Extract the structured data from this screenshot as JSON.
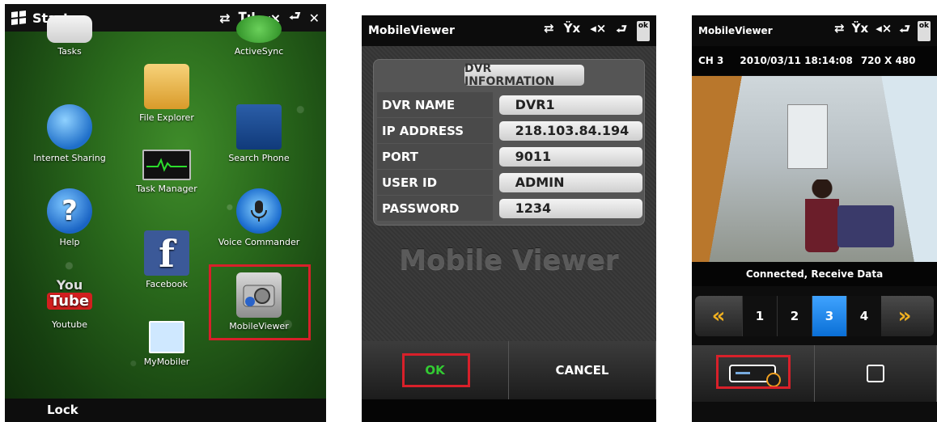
{
  "panel1": {
    "start_title": "Start",
    "status_icons": [
      "⇄",
      "𝐓ıl",
      "◂×",
      "⮐",
      "✕"
    ],
    "apps": [
      {
        "label": "Tasks",
        "icon": "tasks-icon"
      },
      {
        "label": "ActiveSync",
        "icon": "activesync-icon"
      },
      {
        "label": "File Explorer",
        "icon": "folder-icon"
      },
      {
        "label": "Internet Sharing",
        "icon": "globe-icon"
      },
      {
        "label": "Search Phone",
        "icon": "search-icon"
      },
      {
        "label": "Task Manager",
        "icon": "task-manager-icon"
      },
      {
        "label": "Help",
        "icon": "help-icon",
        "glyph": "?"
      },
      {
        "label": "Voice Commander",
        "icon": "microphone-icon"
      },
      {
        "label": "Facebook",
        "icon": "facebook-icon",
        "glyph": "f"
      },
      {
        "label": "MobileViewer",
        "icon": "camera-icon"
      },
      {
        "label": "Youtube",
        "icon": "youtube-icon",
        "glyph_top": "You",
        "glyph_bottom": "Tube"
      },
      {
        "label": "MyMobiler",
        "icon": "mymobiler-icon"
      }
    ],
    "lock_label": "Lock"
  },
  "panel2": {
    "app_title": "MobileViewer",
    "status_icons": [
      "⇄",
      "Ÿx",
      "◂×",
      "⮐"
    ],
    "ok_badge": "ok",
    "info_header": "DVR INFORMATION",
    "rows": [
      {
        "label": "DVR NAME",
        "value": "DVR1"
      },
      {
        "label": "IP ADDRESS",
        "value": "218.103.84.194"
      },
      {
        "label": "PORT",
        "value": "9011"
      },
      {
        "label": "USER ID",
        "value": "ADMIN"
      },
      {
        "label": "PASSWORD",
        "value": "1234"
      }
    ],
    "watermark": "Mobile Viewer",
    "ok_label": "OK",
    "cancel_label": "CANCEL"
  },
  "panel3": {
    "app_title": "MobileViewer",
    "status_icons": [
      "⇄",
      "Ÿx",
      "◂×",
      "⮐"
    ],
    "ok_badge": "ok",
    "channel": "CH 3",
    "timestamp": "2010/03/11 18:14:08",
    "resolution": "720 X 480",
    "status_text": "Connected, Receive Data",
    "prev_arrow": "«",
    "next_arrow": "»",
    "channels": [
      "1",
      "2",
      "3",
      "4"
    ],
    "active_channel": "3"
  },
  "colors": {
    "highlight_red": "#d8202a",
    "ok_green": "#33cc33",
    "active_channel_blue": "#0a6fd6",
    "arrow_orange": "#f0b020"
  }
}
